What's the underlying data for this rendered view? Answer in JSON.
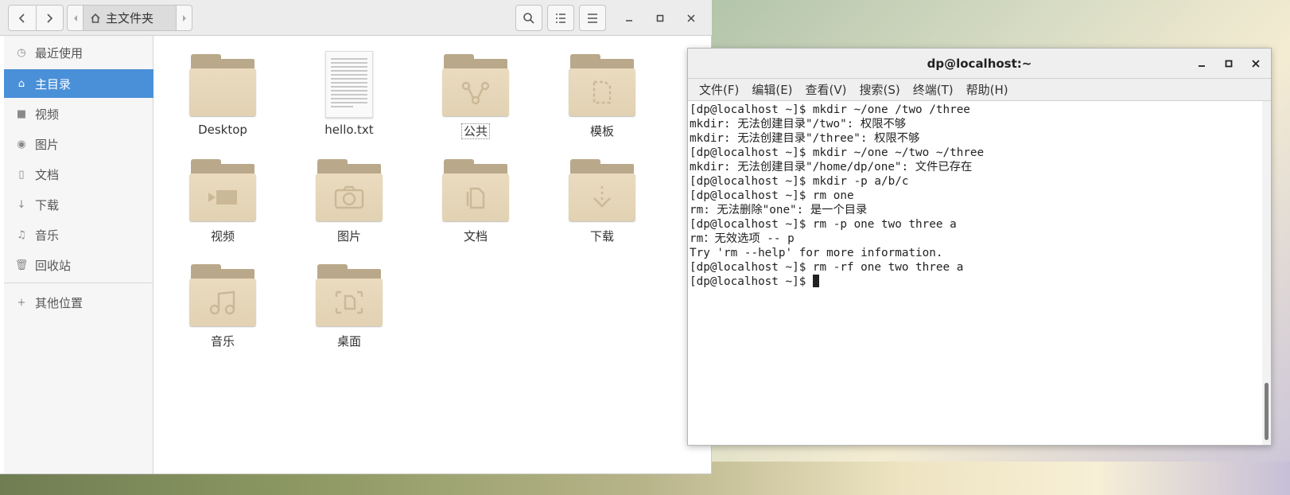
{
  "file_manager": {
    "path": {
      "crumb": "主文件夹"
    },
    "sidebar": [
      {
        "label": "最近使用",
        "icon": "clock-icon"
      },
      {
        "label": "主目录",
        "icon": "home-icon",
        "active": true
      },
      {
        "label": "视频",
        "icon": "video-icon"
      },
      {
        "label": "图片",
        "icon": "camera-icon"
      },
      {
        "label": "文档",
        "icon": "document-icon"
      },
      {
        "label": "下载",
        "icon": "download-icon"
      },
      {
        "label": "音乐",
        "icon": "music-icon"
      },
      {
        "label": "回收站",
        "icon": "trash-icon"
      },
      {
        "label": "其他位置",
        "icon": "plus-icon"
      }
    ],
    "items": [
      {
        "label": "Desktop",
        "type": "folder"
      },
      {
        "label": "hello.txt",
        "type": "text-file"
      },
      {
        "label": "公共",
        "type": "folder-share"
      },
      {
        "label": "模板",
        "type": "folder-template"
      },
      {
        "label": "视频",
        "type": "folder-video"
      },
      {
        "label": "图片",
        "type": "folder-pictures"
      },
      {
        "label": "文档",
        "type": "folder-documents"
      },
      {
        "label": "下载",
        "type": "folder-download"
      },
      {
        "label": "音乐",
        "type": "folder-music"
      },
      {
        "label": "桌面",
        "type": "folder-desktop"
      }
    ]
  },
  "terminal": {
    "title": "dp@localhost:~",
    "menu": [
      "文件(F)",
      "编辑(E)",
      "查看(V)",
      "搜索(S)",
      "终端(T)",
      "帮助(H)"
    ],
    "lines": [
      "[dp@localhost ~]$ mkdir ~/one /two /three",
      "mkdir: 无法创建目录\"/two\": 权限不够",
      "mkdir: 无法创建目录\"/three\": 权限不够",
      "[dp@localhost ~]$ mkdir ~/one ~/two ~/three",
      "mkdir: 无法创建目录\"/home/dp/one\": 文件已存在",
      "[dp@localhost ~]$ mkdir -p a/b/c",
      "[dp@localhost ~]$ rm one",
      "rm: 无法删除\"one\": 是一个目录",
      "[dp@localhost ~]$ rm -p one two three a",
      "rm：无效选项 -- p",
      "Try 'rm --help' for more information.",
      "[dp@localhost ~]$ rm -rf one two three a"
    ],
    "prompt": "[dp@localhost ~]$ "
  }
}
